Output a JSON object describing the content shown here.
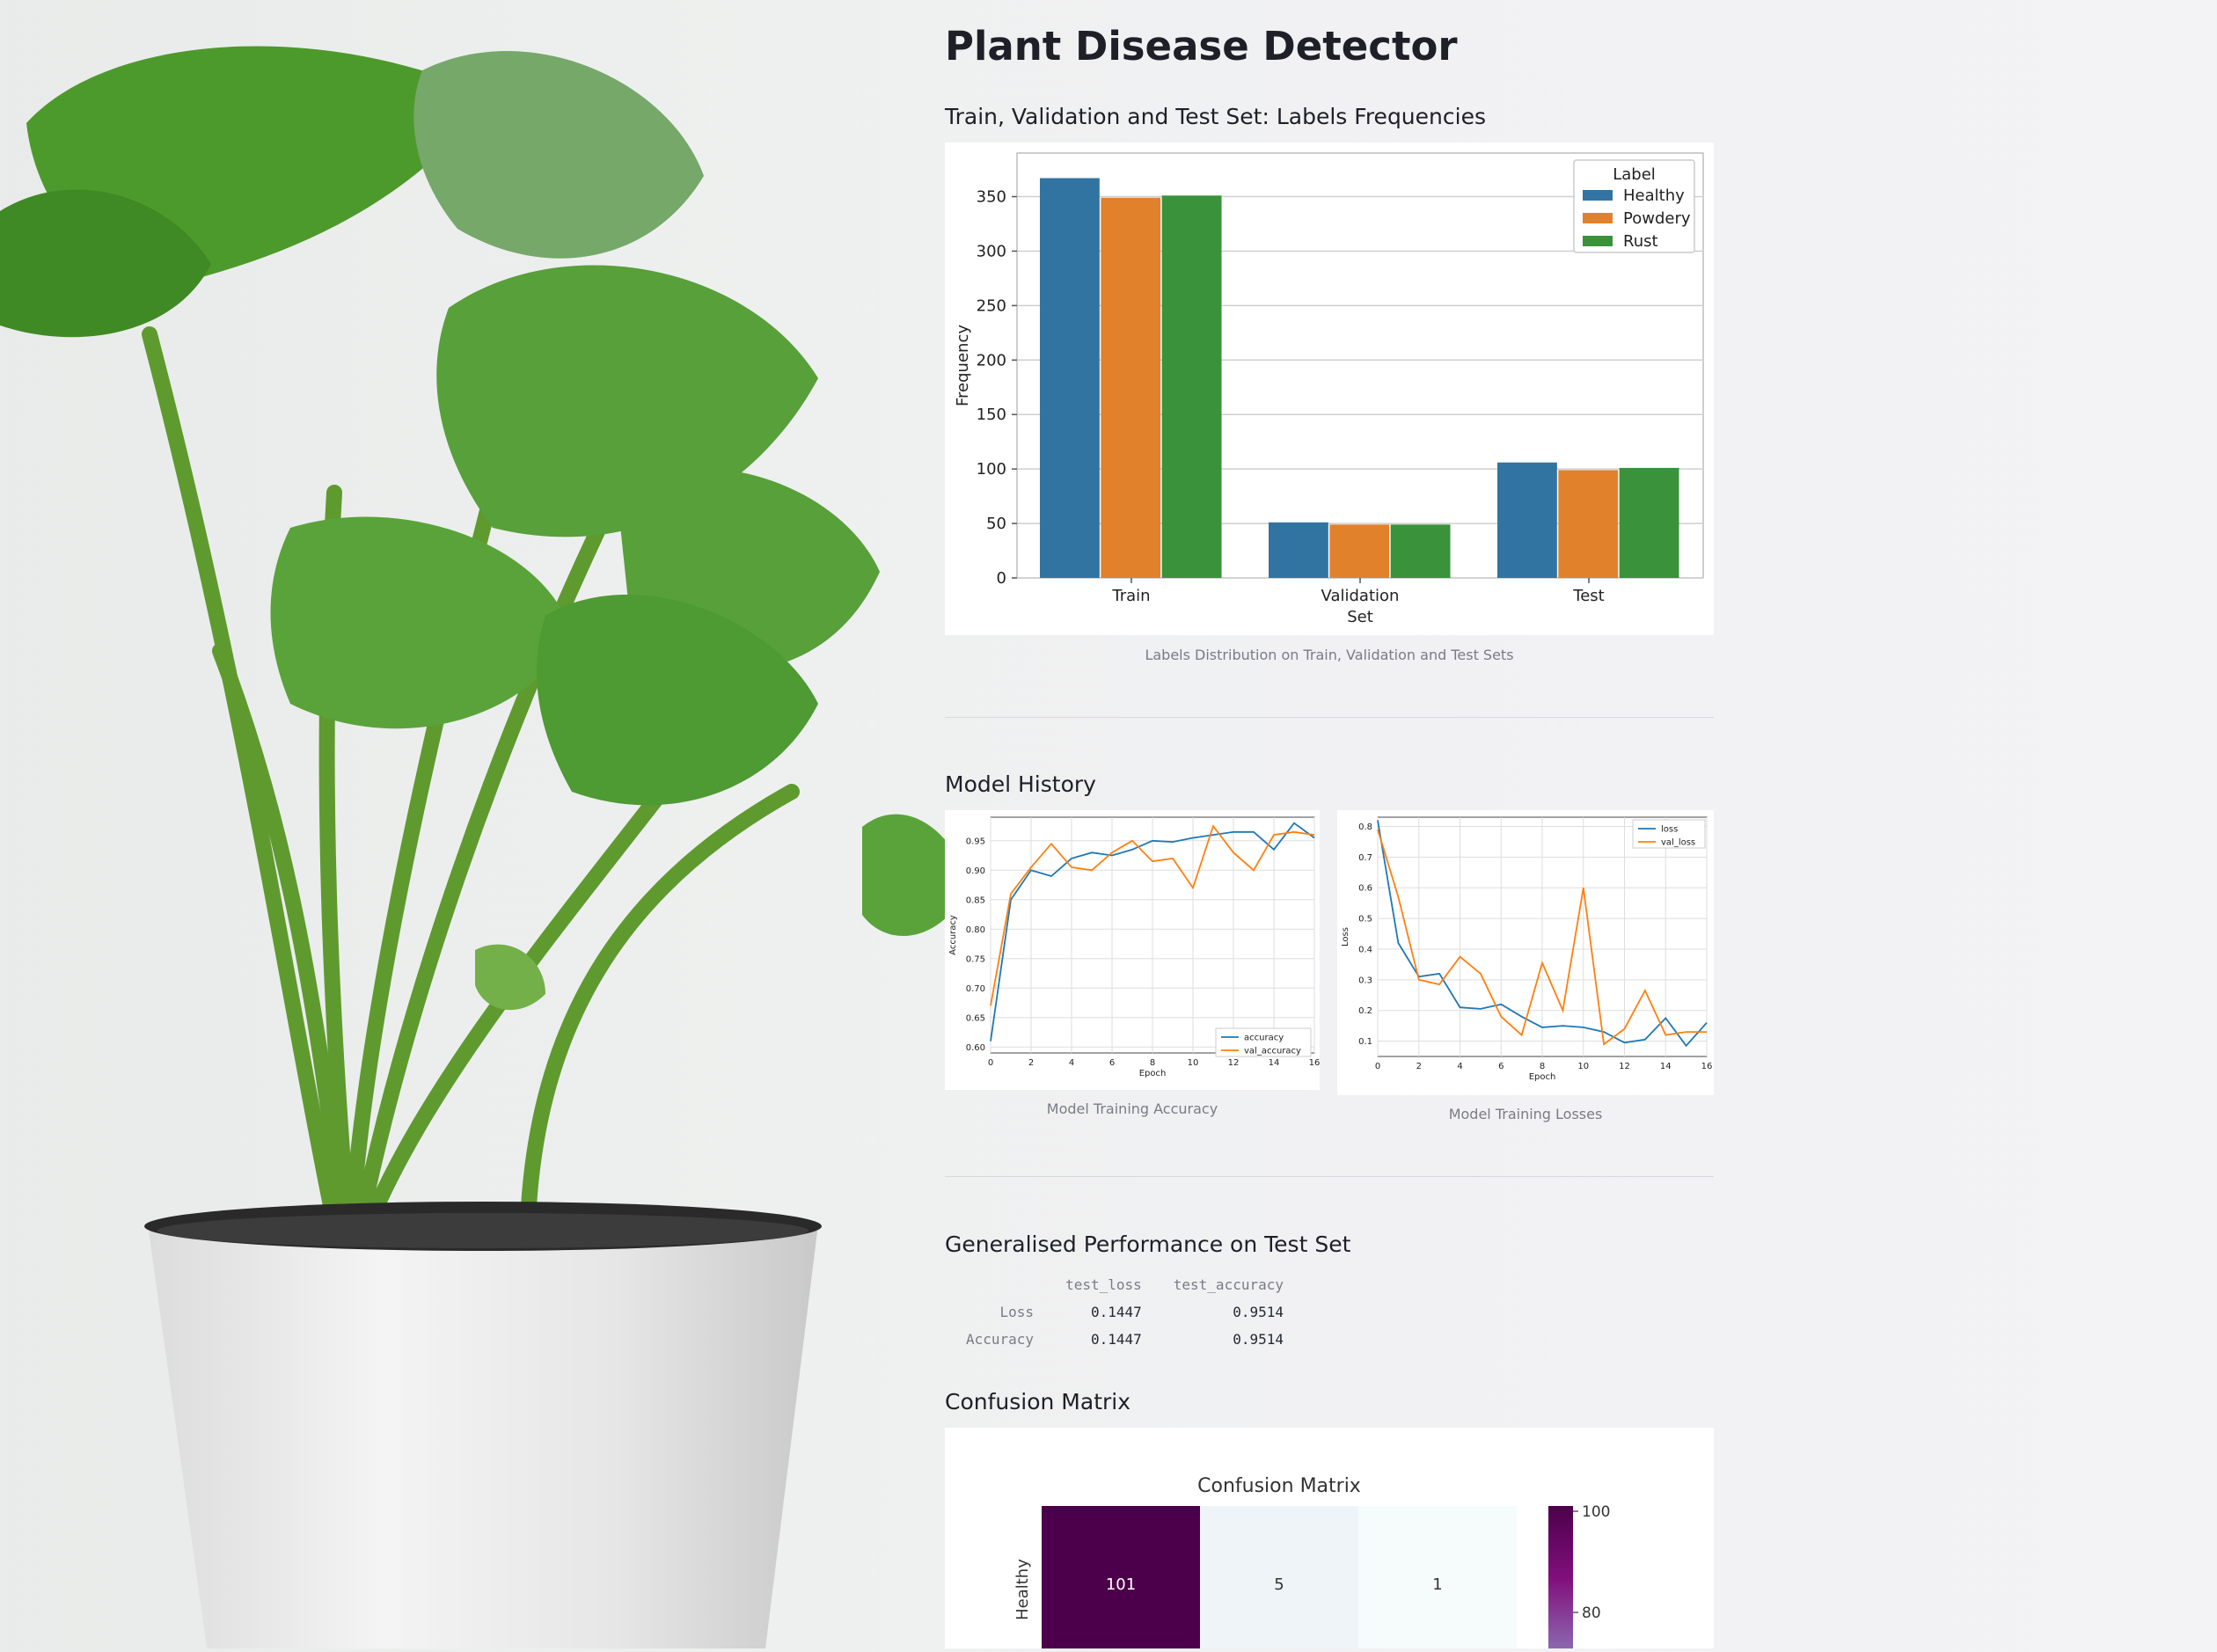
{
  "page": {
    "title": "Plant Disease Detector",
    "section_label_frequencies": "Train, Validation and Test Set: Labels Frequencies",
    "caption_label_distribution": "Labels Distribution on Train, Validation and Test Sets",
    "section_model_history": "Model History",
    "caption_accuracy": "Model Training Accuracy",
    "caption_losses": "Model Training Losses",
    "section_generalised": "Generalised Performance on Test Set",
    "section_confusion": "Confusion Matrix"
  },
  "performance_table": {
    "columns": [
      "test_loss",
      "test_accuracy"
    ],
    "rows": [
      {
        "label": "Loss",
        "values": [
          "0.1447",
          "0.9514"
        ]
      },
      {
        "label": "Accuracy",
        "values": [
          "0.1447",
          "0.9514"
        ]
      }
    ]
  },
  "colors": {
    "healthy": "#3274a1",
    "powdery": "#e1812c",
    "rust": "#3a923a",
    "heat_dark": "#4c004b",
    "heat_light": "#f6fbfc"
  },
  "chart_data": [
    {
      "type": "bar",
      "title": "",
      "xlabel": "Set",
      "ylabel": "Frequency",
      "ylim": [
        0,
        390
      ],
      "yticks": [
        0,
        50,
        100,
        150,
        200,
        250,
        300,
        350
      ],
      "categories": [
        "Train",
        "Validation",
        "Test"
      ],
      "legend_title": "Label",
      "legend_position": "top-right",
      "grid": true,
      "series": [
        {
          "name": "Healthy",
          "values": [
            367,
            51,
            106
          ]
        },
        {
          "name": "Powdery",
          "values": [
            349,
            49,
            99
          ]
        },
        {
          "name": "Rust",
          "values": [
            351,
            49,
            101
          ]
        }
      ]
    },
    {
      "type": "line",
      "xlabel": "Epoch",
      "ylabel": "Accuracy",
      "xlim": [
        0,
        16
      ],
      "ylim": [
        0.59,
        0.99
      ],
      "xticks": [
        0,
        2,
        4,
        6,
        8,
        10,
        12,
        14,
        16
      ],
      "yticks": [
        0.6,
        0.65,
        0.7,
        0.75,
        0.8,
        0.85,
        0.9,
        0.95
      ],
      "legend_position": "bottom-right",
      "grid": true,
      "x": [
        0,
        1,
        2,
        3,
        4,
        5,
        6,
        7,
        8,
        9,
        10,
        11,
        12,
        13,
        14,
        15,
        16
      ],
      "series": [
        {
          "name": "accuracy",
          "values": [
            0.61,
            0.85,
            0.9,
            0.89,
            0.92,
            0.93,
            0.925,
            0.935,
            0.95,
            0.948,
            0.955,
            0.96,
            0.965,
            0.965,
            0.935,
            0.98,
            0.955
          ]
        },
        {
          "name": "val_accuracy",
          "values": [
            0.67,
            0.86,
            0.905,
            0.945,
            0.905,
            0.9,
            0.93,
            0.95,
            0.915,
            0.92,
            0.87,
            0.975,
            0.93,
            0.9,
            0.96,
            0.965,
            0.96
          ]
        }
      ]
    },
    {
      "type": "line",
      "xlabel": "Epoch",
      "ylabel": "Loss",
      "xlim": [
        0,
        16
      ],
      "ylim": [
        0.05,
        0.83
      ],
      "xticks": [
        0,
        2,
        4,
        6,
        8,
        10,
        12,
        14,
        16
      ],
      "yticks": [
        0.1,
        0.2,
        0.3,
        0.4,
        0.5,
        0.6,
        0.7,
        0.8
      ],
      "legend_position": "top-right",
      "grid": true,
      "x": [
        0,
        1,
        2,
        3,
        4,
        5,
        6,
        7,
        8,
        9,
        10,
        11,
        12,
        13,
        14,
        15,
        16
      ],
      "series": [
        {
          "name": "loss",
          "values": [
            0.82,
            0.42,
            0.31,
            0.32,
            0.21,
            0.205,
            0.22,
            0.18,
            0.145,
            0.15,
            0.145,
            0.13,
            0.095,
            0.105,
            0.175,
            0.085,
            0.16
          ]
        },
        {
          "name": "val_loss",
          "values": [
            0.79,
            0.57,
            0.3,
            0.285,
            0.375,
            0.32,
            0.18,
            0.12,
            0.355,
            0.2,
            0.6,
            0.09,
            0.14,
            0.265,
            0.12,
            0.13,
            0.13
          ]
        }
      ]
    },
    {
      "type": "heatmap",
      "title": "Confusion Matrix",
      "row_labels": [
        "Healthy"
      ],
      "values": [
        [
          101,
          5,
          1
        ]
      ],
      "colorbar_ticks": [
        100,
        80
      ]
    }
  ]
}
